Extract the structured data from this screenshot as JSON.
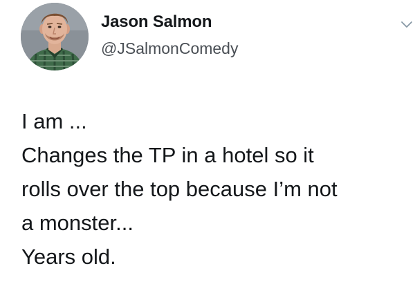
{
  "author": {
    "name": "Jason Salmon",
    "handle": "@JSalmonComedy",
    "avatar_icon": "profile-photo-icon"
  },
  "menu": {
    "icon": "chevron-down-icon"
  },
  "tweet": {
    "lines": [
      "I am ...",
      "Changes the TP in a hotel so it",
      "rolls over the top because I’m not",
      "a monster...",
      "Years old."
    ]
  }
}
